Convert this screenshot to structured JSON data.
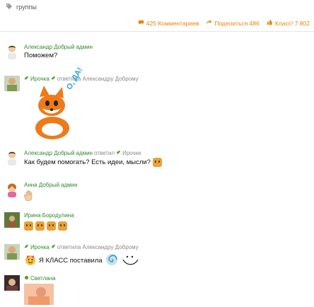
{
  "header": {
    "groups_label": "группы",
    "comments": "425 Комментариев",
    "share": "Поделиться 486",
    "klass": "Класс! 7 802"
  },
  "comments": [
    {
      "author": "Александр Добрый",
      "role": "админ",
      "text": "Поможем?"
    },
    {
      "author": "Ирочка",
      "replied": "ответила Александру Доброму",
      "sticker_text": "О, ДА!"
    },
    {
      "author": "Александр Добрый",
      "role": "админ",
      "replied": "ответил",
      "reply_target": "Ирочке",
      "text": "Как будем помогать? Есть идеи, мысли?"
    },
    {
      "author": "Анна Добрый",
      "role": "админ"
    },
    {
      "author": "Ирина Бородулина"
    },
    {
      "author": "Ирочка",
      "replied": "ответила Александру Доброму",
      "text": "Я КЛАСС поставила"
    },
    {
      "author": "Светлана"
    }
  ]
}
